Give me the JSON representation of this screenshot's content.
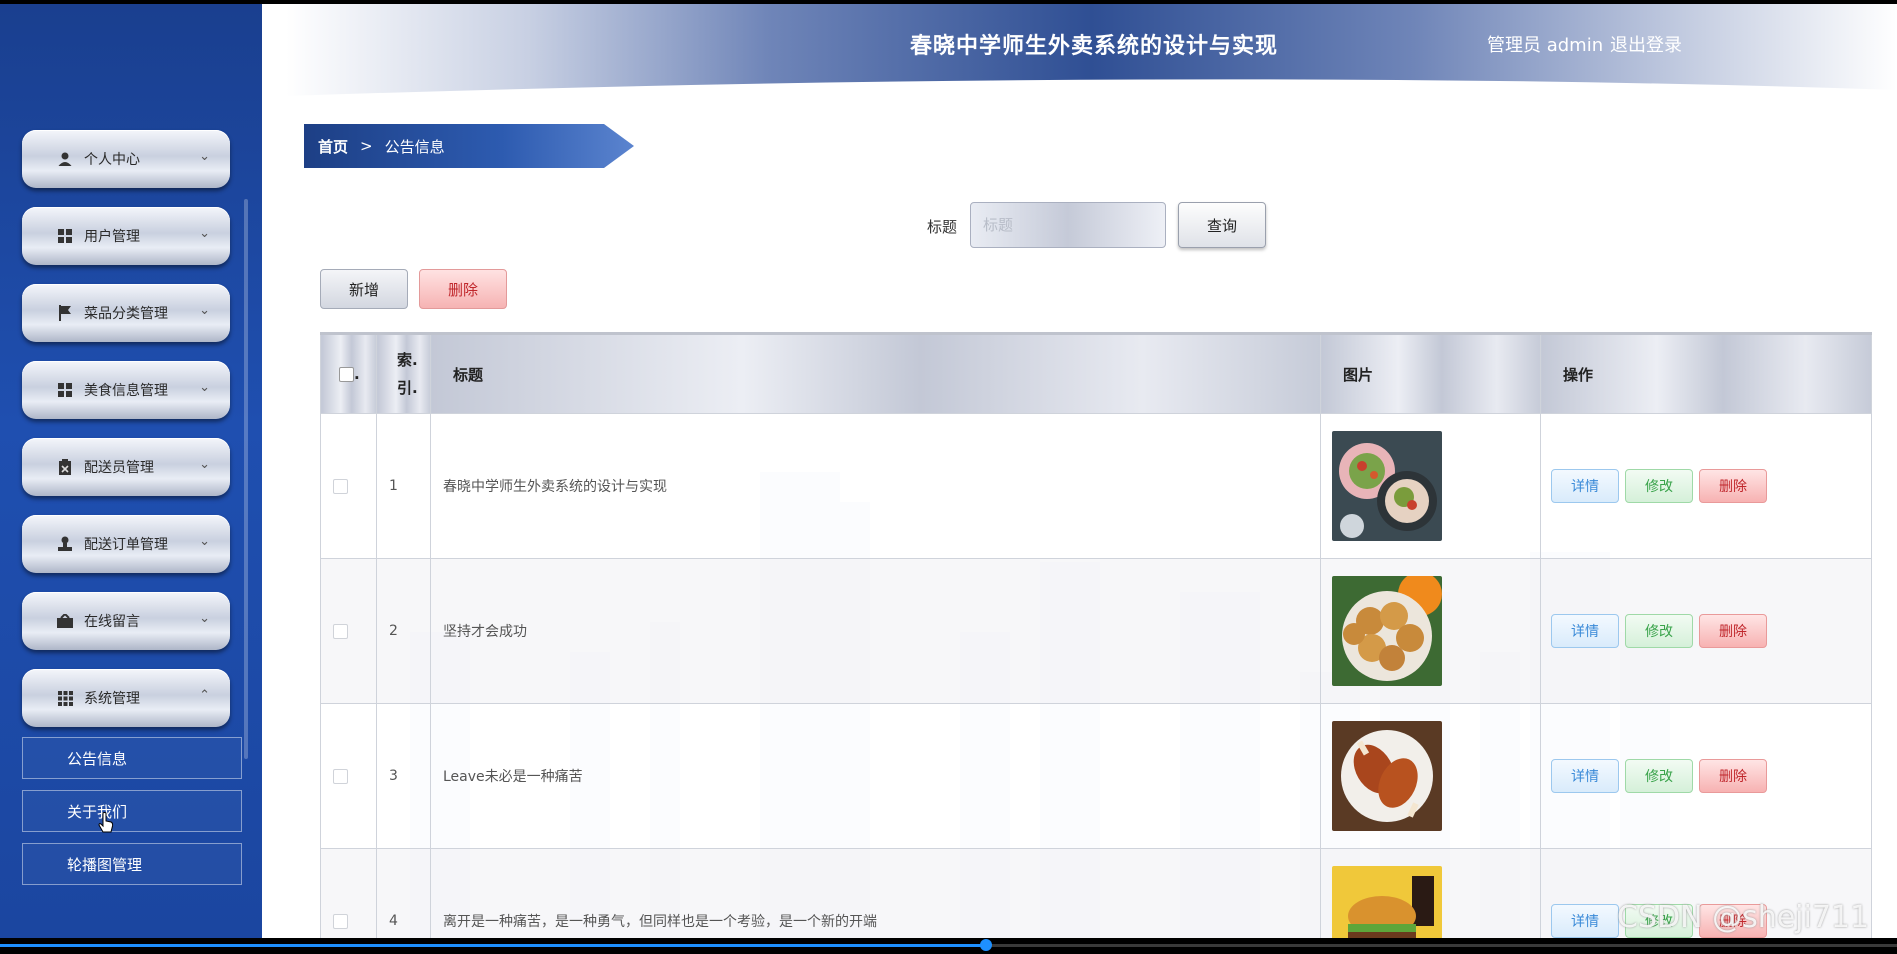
{
  "app": {
    "title": "春晓中学师生外卖系统的设计与实现",
    "user_label": "管理员 admin",
    "logout_label": "退出登录"
  },
  "sidebar": {
    "items": [
      {
        "label": "个人中心",
        "icon": "person-icon",
        "expanded": false
      },
      {
        "label": "用户管理",
        "icon": "grid-icon",
        "expanded": false
      },
      {
        "label": "菜品分类管理",
        "icon": "flag-icon",
        "expanded": false
      },
      {
        "label": "美食信息管理",
        "icon": "grid-icon",
        "expanded": false
      },
      {
        "label": "配送员管理",
        "icon": "clipboard-icon",
        "expanded": false
      },
      {
        "label": "配送订单管理",
        "icon": "stamp-icon",
        "expanded": false
      },
      {
        "label": "在线留言",
        "icon": "message-icon",
        "expanded": false
      },
      {
        "label": "系统管理",
        "icon": "apps-icon",
        "expanded": true
      }
    ],
    "sub_items": [
      {
        "label": "公告信息"
      },
      {
        "label": "关于我们"
      },
      {
        "label": "轮播图管理"
      }
    ]
  },
  "breadcrumb": {
    "home": "首页",
    "separator": ">",
    "current": "公告信息"
  },
  "search": {
    "label": "标题",
    "placeholder": "标题",
    "value": "",
    "button": "查询"
  },
  "actions": {
    "add": "新增",
    "delete": "删除"
  },
  "table": {
    "headers": {
      "check": ".",
      "index": "索.引.",
      "title": "标题",
      "picture": "图片",
      "ops": "操作"
    },
    "op_labels": {
      "detail": "详情",
      "edit": "修改",
      "delete": "删除"
    },
    "rows": [
      {
        "index": "1",
        "title": "春晓中学师生外卖系统的设计与实现",
        "image": "salad-plates"
      },
      {
        "index": "2",
        "title": "坚持才会成功",
        "image": "fried-balls"
      },
      {
        "index": "3",
        "title": "Leave未必是一种痛苦",
        "image": "roast-chicken"
      },
      {
        "index": "4",
        "title": "离开是一种痛苦，是一种勇气，但同样也是一个考验，是一个新的开端",
        "image": "burger"
      }
    ]
  },
  "watermark": "CSDN @sheji711",
  "video": {
    "progress": 0.52
  },
  "colors": {
    "sidebar_bg": "#1f4fb0",
    "header_accent": "#2f4f94",
    "detail": "#3a8ad8",
    "edit": "#39a34a",
    "danger": "#c0262b"
  }
}
